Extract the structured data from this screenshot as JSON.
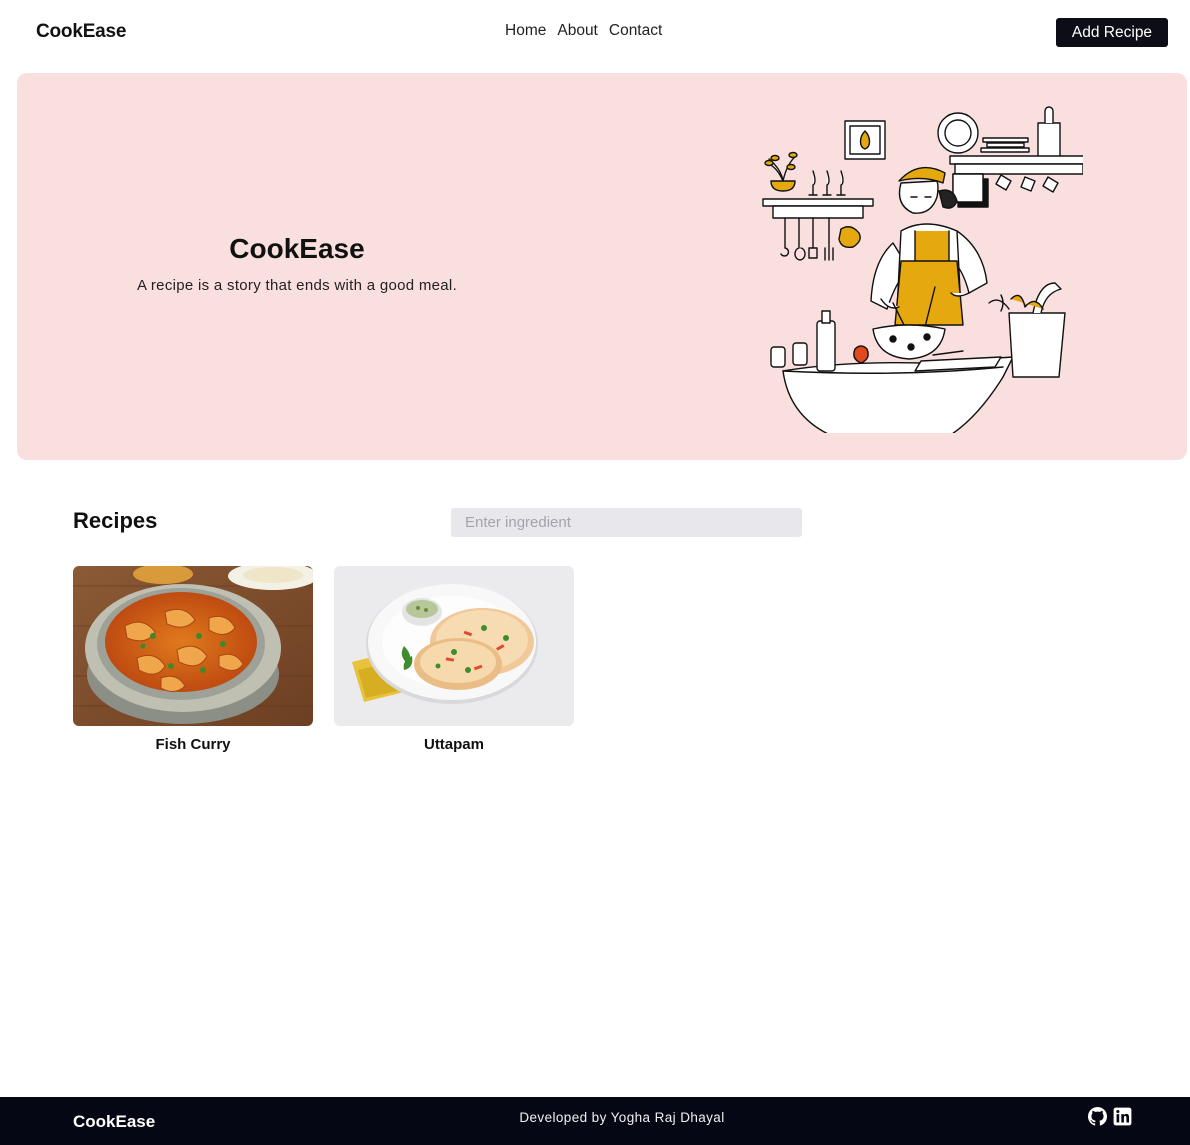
{
  "navbar": {
    "brand": "CookEase",
    "links": [
      "Home",
      "About",
      "Contact"
    ],
    "add_button": "Add Recipe"
  },
  "hero": {
    "title": "CookEase",
    "subtitle": "A recipe is a story that ends with a good meal."
  },
  "recipes": {
    "title": "Recipes",
    "search_placeholder": "Enter ingredient",
    "search_value": "",
    "items": [
      {
        "name": "Fish Curry"
      },
      {
        "name": "Uttapam"
      }
    ]
  },
  "footer": {
    "brand": "CookEase",
    "credit": "Developed by Yogha Raj Dhayal",
    "icons": [
      "github-icon",
      "linkedin-icon"
    ]
  },
  "colors": {
    "hero_bg": "#f9e0de",
    "button_bg": "#0c0d16",
    "footer_bg": "#050814",
    "search_bg": "#e8e8ec",
    "accent_mustard": "#e5a90f"
  }
}
